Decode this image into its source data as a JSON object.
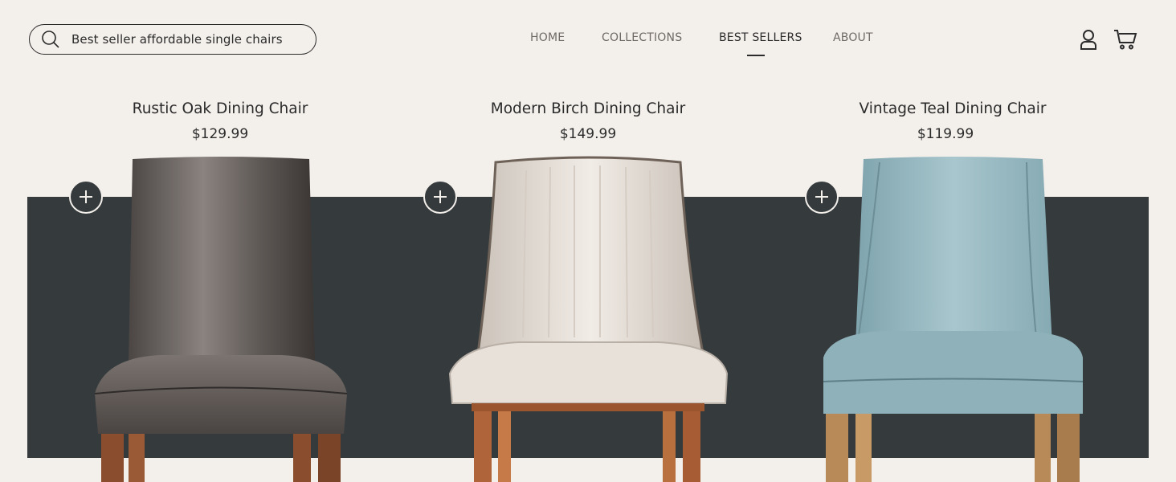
{
  "search": {
    "value": "Best seller affordable single chairs"
  },
  "nav": {
    "items": [
      {
        "label": "HOME"
      },
      {
        "label": "COLLECTIONS"
      },
      {
        "label": "BEST SELLERS"
      },
      {
        "label": "ABOUT"
      }
    ]
  },
  "header": {
    "account_icon": "user-icon",
    "cart_icon": "cart-icon"
  },
  "products": [
    {
      "title": "Rustic Oak Dining Chair",
      "price": "$129.99",
      "icon": "plus-icon"
    },
    {
      "title": "Modern Birch Dining Chair",
      "price": "$149.99",
      "icon": "plus-icon"
    },
    {
      "title": "Vintage Teal Dining Chair",
      "price": "$119.99",
      "icon": "plus-icon"
    }
  ],
  "colors": {
    "background": "#f3efeb",
    "band": "#353a3d",
    "text": "#2b2b2b",
    "nav_muted": "#6f6a66"
  }
}
